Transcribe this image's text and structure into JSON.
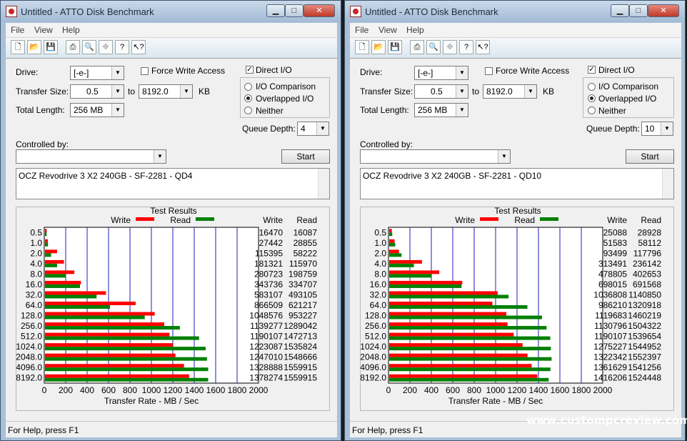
{
  "windows": [
    {
      "title": "Untitled - ATTO Disk Benchmark",
      "menu": [
        "File",
        "View",
        "Help"
      ],
      "drive": {
        "label": "Drive:",
        "value": "[-e-]"
      },
      "force_write": {
        "label": "Force Write Access",
        "checked": false
      },
      "direct_io": {
        "label": "Direct I/O",
        "checked": true
      },
      "transfer_size": {
        "label": "Transfer Size:",
        "from": "0.5",
        "to_label": "to",
        "to": "8192.0",
        "unit": "KB"
      },
      "total_length": {
        "label": "Total Length:",
        "value": "256 MB"
      },
      "io_modes": [
        {
          "label": "I/O Comparison",
          "selected": false
        },
        {
          "label": "Overlapped I/O",
          "selected": true
        },
        {
          "label": "Neither",
          "selected": false
        }
      ],
      "queue_depth": {
        "label": "Queue Depth:",
        "value": "4"
      },
      "controlled_by": {
        "label": "Controlled by:",
        "value": ""
      },
      "start_label": "Start",
      "description": "OCZ Revodrive 3 X2 240GB - SF-2281 - QD4",
      "status": "For Help, press F1",
      "chart_data": {
        "type": "bar",
        "orientation": "horizontal",
        "title": "Test Results",
        "xlabel": "Transfer Rate - MB / Sec",
        "xlim": [
          0,
          2000
        ],
        "xticks": [
          "0",
          "200",
          "400",
          "600",
          "800",
          "1000",
          "1200",
          "1400",
          "1600",
          "1800",
          "2000"
        ],
        "grid": true,
        "legend": [
          {
            "name": "Write",
            "color": "#ff0000"
          },
          {
            "name": "Read",
            "color": "#008000"
          }
        ],
        "column_headers": [
          "Write",
          "Read"
        ],
        "categories": [
          "0.5",
          "1.0",
          "2.0",
          "4.0",
          "8.0",
          "16.0",
          "32.0",
          "64.0",
          "128.0",
          "256.0",
          "512.0",
          "1024.0",
          "2048.0",
          "4096.0",
          "8192.0"
        ],
        "series": [
          {
            "name": "Write",
            "color": "#ff0000",
            "values": [
              16470,
              27442,
              115395,
              181321,
              280723,
              343736,
              583107,
              866509,
              1048576,
              1139277,
              1190107,
              1223087,
              1247010,
              1328888,
              1378274
            ]
          },
          {
            "name": "Read",
            "color": "#008000",
            "values": [
              16087,
              28855,
              58222,
              115970,
              198759,
              334707,
              493105,
              621217,
              953227,
              1289042,
              1472713,
              1535824,
              1548666,
              1559915,
              1559915
            ]
          }
        ]
      }
    },
    {
      "title": "Untitled - ATTO Disk Benchmark",
      "menu": [
        "File",
        "View",
        "Help"
      ],
      "drive": {
        "label": "Drive:",
        "value": "[-e-]"
      },
      "force_write": {
        "label": "Force Write Access",
        "checked": false
      },
      "direct_io": {
        "label": "Direct I/O",
        "checked": true
      },
      "transfer_size": {
        "label": "Transfer Size:",
        "from": "0.5",
        "to_label": "to",
        "to": "8192.0",
        "unit": "KB"
      },
      "total_length": {
        "label": "Total Length:",
        "value": "256 MB"
      },
      "io_modes": [
        {
          "label": "I/O Comparison",
          "selected": false
        },
        {
          "label": "Overlapped I/O",
          "selected": true
        },
        {
          "label": "Neither",
          "selected": false
        }
      ],
      "queue_depth": {
        "label": "Queue Depth:",
        "value": "10"
      },
      "controlled_by": {
        "label": "Controlled by:",
        "value": ""
      },
      "start_label": "Start",
      "description": "OCZ Revodrive 3 X2 240GB - SF-2281 - QD10",
      "status": "For Help, press F1",
      "chart_data": {
        "type": "bar",
        "orientation": "horizontal",
        "title": "Test Results",
        "xlabel": "Transfer Rate - MB / Sec",
        "xlim": [
          0,
          2000
        ],
        "xticks": [
          "0",
          "200",
          "400",
          "600",
          "800",
          "1000",
          "1200",
          "1400",
          "1600",
          "1800",
          "2000"
        ],
        "grid": true,
        "legend": [
          {
            "name": "Write",
            "color": "#ff0000"
          },
          {
            "name": "Read",
            "color": "#008000"
          }
        ],
        "column_headers": [
          "Write",
          "Read"
        ],
        "categories": [
          "0.5",
          "1.0",
          "2.0",
          "4.0",
          "8.0",
          "16.0",
          "32.0",
          "64.0",
          "128.0",
          "256.0",
          "512.0",
          "1024.0",
          "2048.0",
          "4096.0",
          "8192.0"
        ],
        "series": [
          {
            "name": "Write",
            "color": "#ff0000",
            "values": [
              25088,
              51583,
              93499,
              313491,
              478805,
              698015,
              1036808,
              986210,
              1119683,
              1130796,
              1190107,
              1275227,
              1322342,
              1361629,
              1416206
            ]
          },
          {
            "name": "Read",
            "color": "#008000",
            "values": [
              28928,
              58112,
              117796,
              236142,
              402653,
              691568,
              1140850,
              1320918,
              1460219,
              1504322,
              1539654,
              1544952,
              1552397,
              1541256,
              1524448
            ]
          }
        ]
      }
    }
  ],
  "watermark": "www.custompcreview.com"
}
